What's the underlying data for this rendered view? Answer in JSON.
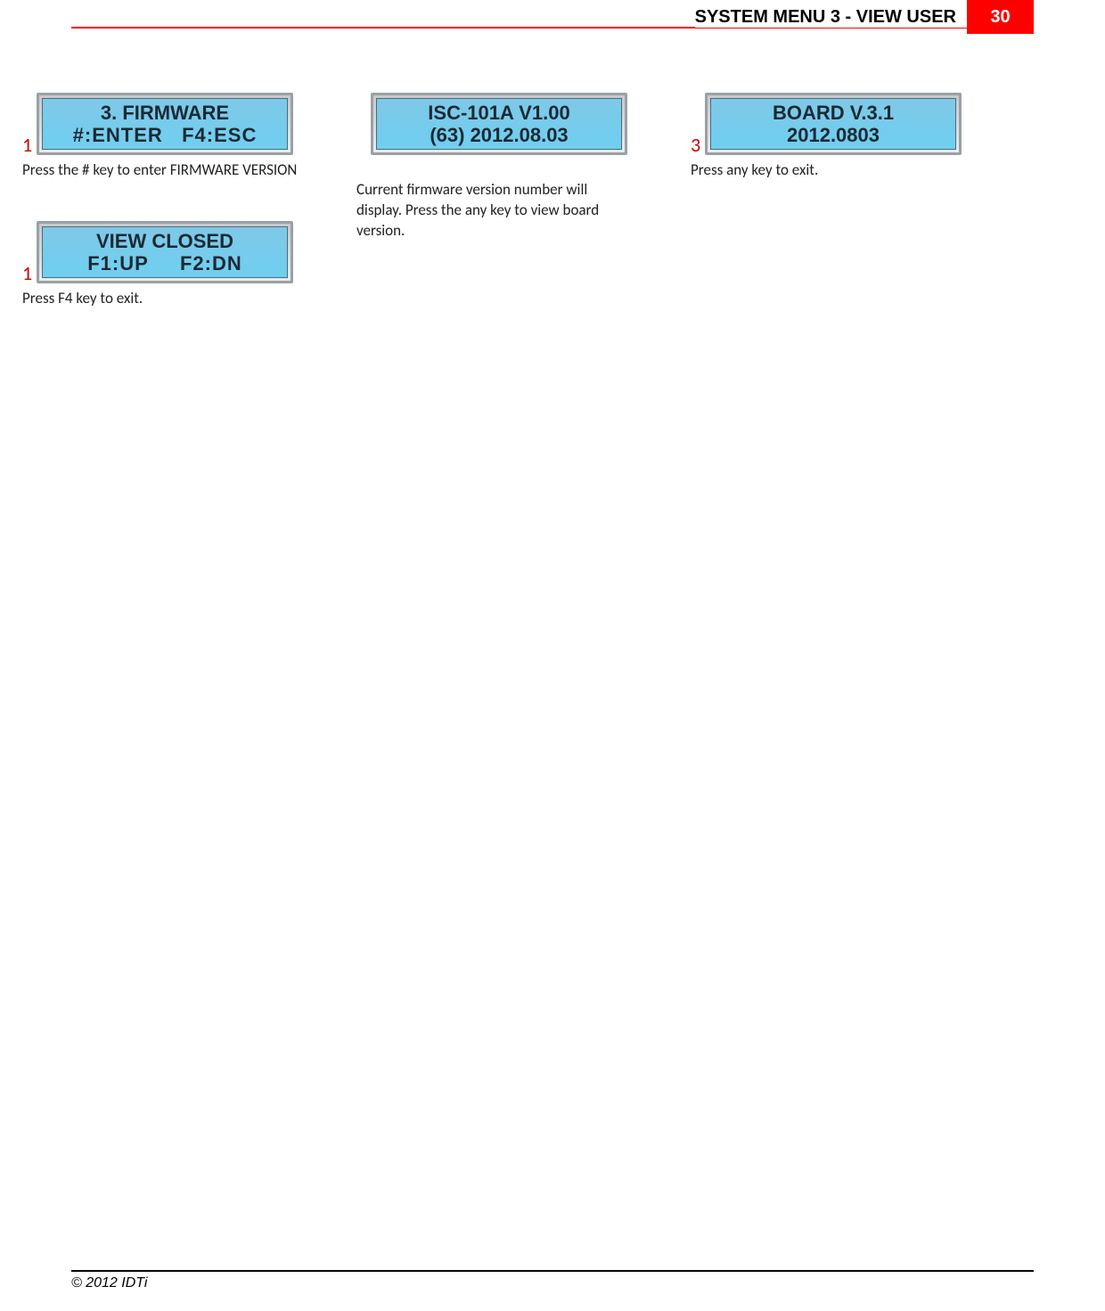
{
  "header": {
    "title": "SYSTEM MENU 3 - VIEW USER",
    "page_number": "30"
  },
  "steps": {
    "s1": {
      "num": "1",
      "lcd_line1": "3. FIRMWARE",
      "lcd_line2": "#:ENTER   F4:ESC",
      "caption": "Press the # key to enter FIRMWARE VERSION"
    },
    "s2": {
      "num": "",
      "lcd_line1": "ISC-101A V1.00",
      "lcd_line2": "(63) 2012.08.03",
      "caption": "Current firmware version number will display. Press the any key to view board version."
    },
    "s3": {
      "num": "3",
      "lcd_line1": "BOARD V.3.1",
      "lcd_line2": "2012.0803",
      "caption": "Press any key to exit."
    },
    "s4": {
      "num": "1",
      "lcd_line1": "VIEW CLOSED",
      "lcd_line2": "F1:UP     F2:DN",
      "caption": "Press F4 key to exit."
    }
  },
  "footer": {
    "copyright": "© 2012 IDTi"
  }
}
